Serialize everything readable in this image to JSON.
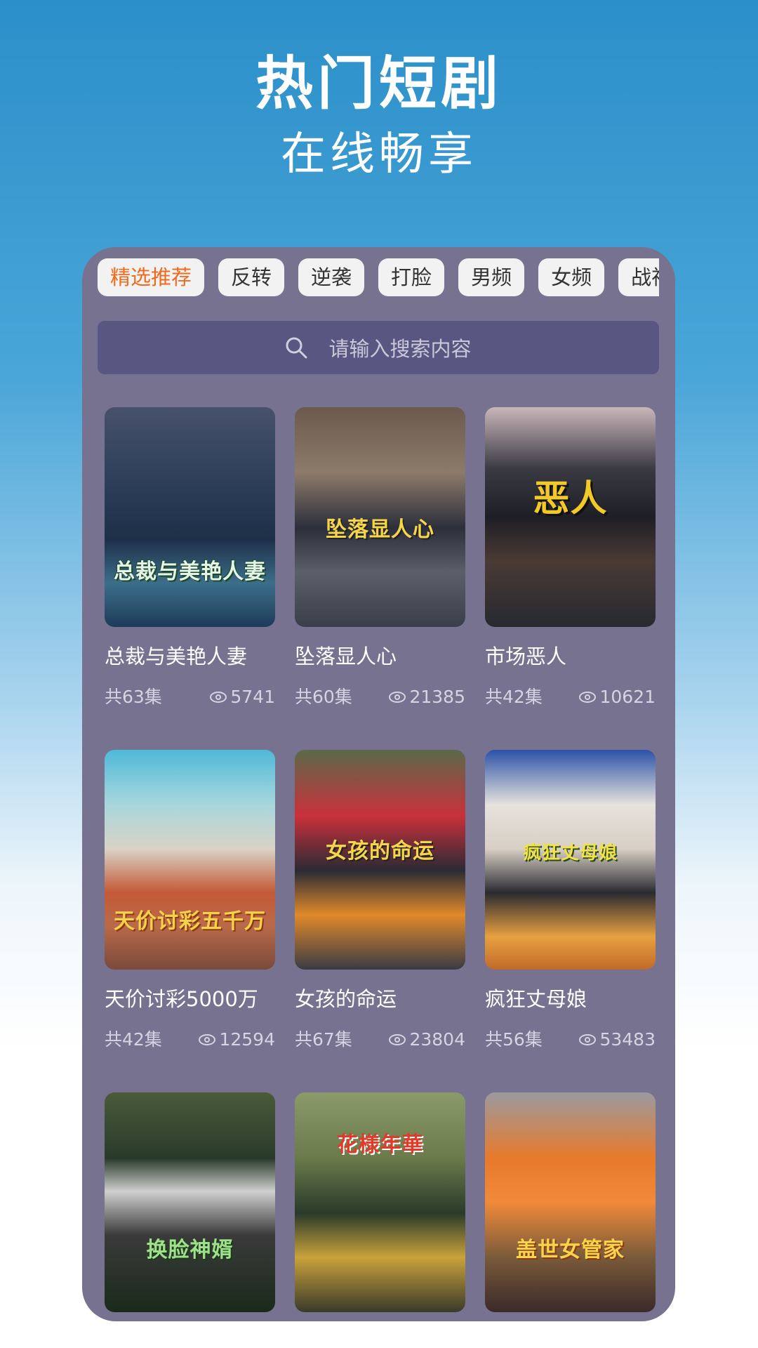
{
  "hero": {
    "title": "热门短剧",
    "subtitle": "在线畅享"
  },
  "tabs": [
    {
      "label": "精选推荐",
      "active": true
    },
    {
      "label": "反转",
      "active": false
    },
    {
      "label": "逆袭",
      "active": false
    },
    {
      "label": "打脸",
      "active": false
    },
    {
      "label": "男频",
      "active": false
    },
    {
      "label": "女频",
      "active": false
    },
    {
      "label": "战神",
      "active": false
    }
  ],
  "search": {
    "placeholder": "请输入搜索内容",
    "icon": "search-icon"
  },
  "colors": {
    "panel": "#76728f",
    "active_tab": "#f06a1e",
    "search_bg": "#5a5682"
  },
  "dramas": [
    {
      "title": "总裁与美艳人妻",
      "poster_text": "总裁与美艳人妻",
      "episodes": "共63集",
      "views": "5741"
    },
    {
      "title": "坠落显人心",
      "poster_text": "坠落显人心",
      "episodes": "共60集",
      "views": "21385"
    },
    {
      "title": "市场恶人",
      "poster_text": "恶人",
      "episodes": "共42集",
      "views": "10621"
    },
    {
      "title": "天价讨彩5000万",
      "poster_text": "天价讨彩五千万",
      "episodes": "共42集",
      "views": "12594"
    },
    {
      "title": "女孩的命运",
      "poster_text": "女孩的命运",
      "episodes": "共67集",
      "views": "23804"
    },
    {
      "title": "疯狂丈母娘",
      "poster_text": "疯狂丈母娘",
      "episodes": "共56集",
      "views": "53483"
    },
    {
      "title": "",
      "poster_text": "换脸神婿",
      "episodes": "",
      "views": ""
    },
    {
      "title": "",
      "poster_text": "花様年華",
      "episodes": "",
      "views": ""
    },
    {
      "title": "",
      "poster_text": "盖世女管家",
      "episodes": "",
      "views": ""
    }
  ]
}
